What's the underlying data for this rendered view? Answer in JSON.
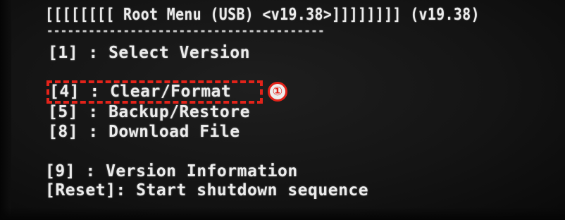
{
  "header": {
    "title_line": "[[[[[[[[ Root Menu (USB) <v19.38>]]]]]]]] (v19.38)",
    "separator": "----------------------------------------"
  },
  "menu": {
    "items": [
      {
        "key": "[1]",
        "text": "[1] : Select Version"
      },
      {
        "key": "[4]",
        "text": "[4] : Clear/Format"
      },
      {
        "key": "[5]",
        "text": "[5] : Backup/Restore"
      },
      {
        "key": "[8]",
        "text": "[8] : Download File"
      },
      {
        "key": "[9]",
        "text": "[9] : Version Information"
      },
      {
        "key": "[Reset]",
        "text": "[Reset]: Start shutdown sequence"
      }
    ]
  },
  "annotation": {
    "callout_number": "①",
    "highlight_color": "#e2231a"
  },
  "colors": {
    "screen_background": "#141414",
    "text": "#ececec"
  }
}
